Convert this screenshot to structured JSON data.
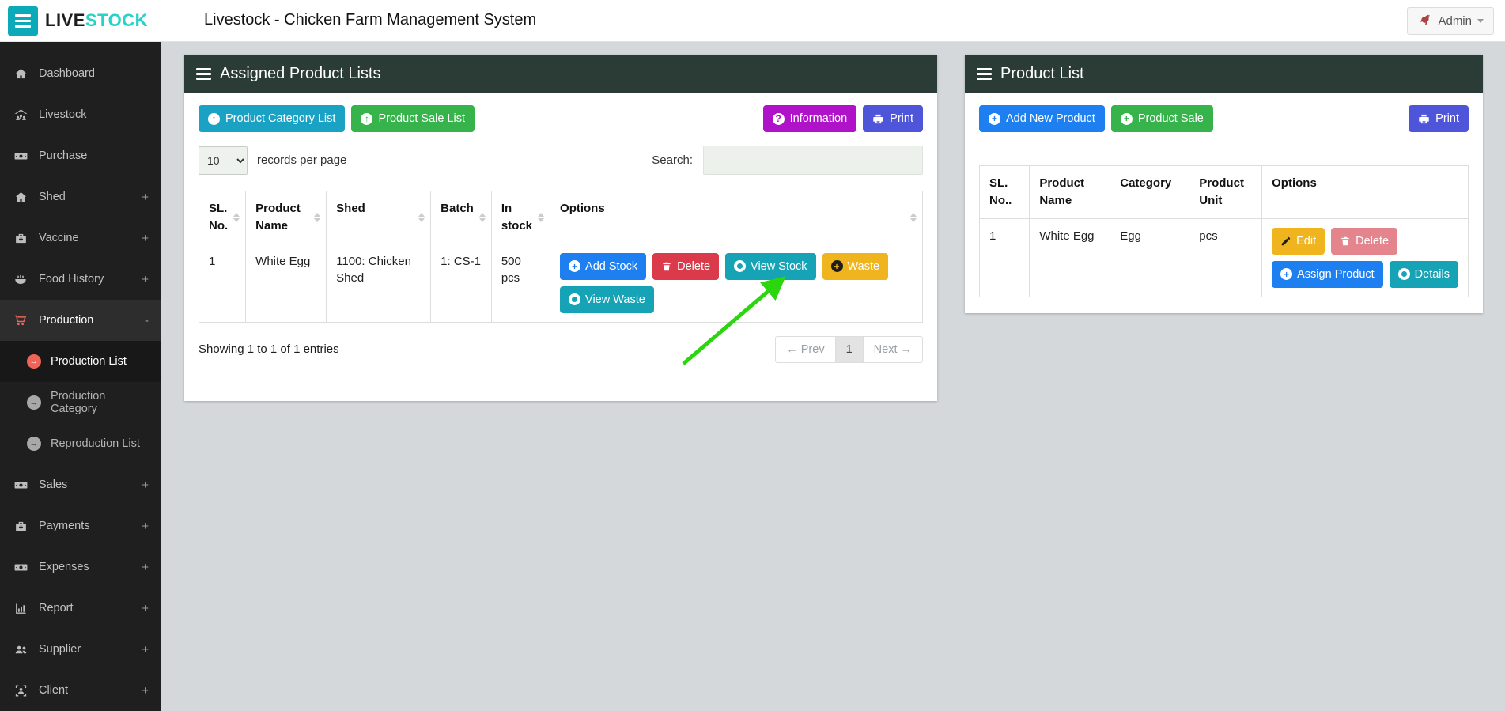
{
  "topbar": {
    "logo_primary": "LIVE",
    "logo_accent": "STOCK",
    "title": "Livestock - Chicken Farm Management System",
    "admin_label": "Admin"
  },
  "sidebar": {
    "items": [
      {
        "label": "Dashboard",
        "icon": "home-icon",
        "expand": ""
      },
      {
        "label": "Livestock",
        "icon": "livestock-icon",
        "expand": ""
      },
      {
        "label": "Purchase",
        "icon": "money-icon",
        "expand": ""
      },
      {
        "label": "Shed",
        "icon": "home-icon",
        "expand": "+"
      },
      {
        "label": "Vaccine",
        "icon": "medkit-icon",
        "expand": "+"
      },
      {
        "label": "Food History",
        "icon": "food-bowl-icon",
        "expand": "+"
      },
      {
        "label": "Production",
        "icon": "cart-icon",
        "expand": "-"
      },
      {
        "label": "Sales",
        "icon": "money-icon",
        "expand": "+"
      },
      {
        "label": "Payments",
        "icon": "medkit-icon",
        "expand": "+"
      },
      {
        "label": "Expenses",
        "icon": "money-icon",
        "expand": "+"
      },
      {
        "label": "Report",
        "icon": "chart-icon",
        "expand": "+"
      },
      {
        "label": "Supplier",
        "icon": "users-icon",
        "expand": "+"
      },
      {
        "label": "Client",
        "icon": "client-icon",
        "expand": "+"
      }
    ],
    "production_children": [
      {
        "label": "Production List",
        "icon": "arrow-circle-icon"
      },
      {
        "label": "Production Category",
        "icon": "arrow-circle-icon"
      },
      {
        "label": "Reproduction List",
        "icon": "arrow-circle-icon"
      }
    ]
  },
  "assigned_panel": {
    "title": "Assigned Product Lists",
    "btn_category_list": "Product Category List",
    "btn_sale_list": "Product Sale List",
    "btn_information": "Information",
    "btn_print": "Print",
    "records_value": "10",
    "records_label": "records per page",
    "search_label": "Search:",
    "headers": [
      "SL. No.",
      "Product Name",
      "Shed",
      "Batch",
      "In stock",
      "Options"
    ],
    "row": {
      "sl": "1",
      "product": "White Egg",
      "shed": "1100: Chicken Shed",
      "batch": "1: CS-1",
      "stock": "500 pcs"
    },
    "btn_add_stock": "Add Stock",
    "btn_delete": "Delete",
    "btn_view_stock": "View Stock",
    "btn_waste": "Waste",
    "btn_view_waste": "View Waste",
    "showing": "Showing 1 to 1 of 1 entries",
    "prev": "← Prev",
    "page": "1",
    "next": "Next →"
  },
  "product_panel": {
    "title": "Product List",
    "btn_add_new": "Add New Product",
    "btn_product_sale": "Product Sale",
    "btn_print": "Print",
    "headers": [
      "SL. No..",
      "Product Name",
      "Category",
      "Product Unit",
      "Options"
    ],
    "row": {
      "sl": "1",
      "product": "White Egg",
      "category": "Egg",
      "unit": "pcs"
    },
    "btn_edit": "Edit",
    "btn_delete": "Delete",
    "btn_assign": "Assign Product",
    "btn_details": "Details"
  },
  "annotation": {
    "type": "arrow",
    "points_to": "Waste button",
    "color": "#2bd60f"
  },
  "colors": {
    "brand_teal": "#0ca9b8",
    "logo_accent": "#27d2c6",
    "panel_header": "#2b3c36",
    "sidebar_bg": "#1f1f1f",
    "active_red": "#ef6458",
    "btn_teal_list": "#1aa2c4",
    "btn_green": "#36b34a",
    "btn_purple": "#b012c9",
    "btn_indigo": "#4f55d9",
    "btn_blue": "#1e80f0",
    "btn_red": "#da3a4a",
    "btn_view_teal": "#16a3b5",
    "btn_yellow": "#f0b41f",
    "btn_pink": "#e4858e"
  }
}
